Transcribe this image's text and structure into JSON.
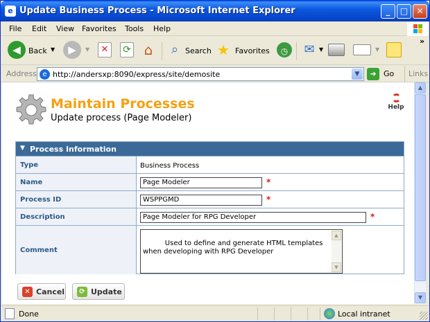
{
  "window": {
    "title": "Update Business Process - Microsoft Internet Explorer"
  },
  "menu": [
    "File",
    "Edit",
    "View",
    "Favorites",
    "Tools",
    "Help"
  ],
  "toolbar": {
    "back_label": "Back",
    "search_label": "Search",
    "favorites_label": "Favorites"
  },
  "address": {
    "label": "Address",
    "url": "http://andersxp:8090/express/site/demosite",
    "go_label": "Go",
    "links_label": "Links"
  },
  "page": {
    "title": "Maintain Processes",
    "subtitle": "Update process (Page Modeler)",
    "help_label": "Help"
  },
  "panel": {
    "title": "Process Information",
    "type_label": "Type",
    "type_value": "Business Process",
    "name_label": "Name",
    "name_value": "Page Modeler",
    "id_label": "Process ID",
    "id_value": "WSPPGMD",
    "description_label": "Description",
    "description_value": "Page Modeler for RPG Developer",
    "comment_label": "Comment",
    "comment_value": "Used to define and generate HTML templates when developing with RPG Developer",
    "required_mark": "*"
  },
  "buttons": {
    "cancel_label": "Cancel",
    "update_label": "Update"
  },
  "status": {
    "text": "Done",
    "zone": "Local intranet"
  },
  "colors": {
    "title_accent": "#f5a113",
    "panel_header": "#3b6a98",
    "label_text": "#2d5a87",
    "required": "#d0201a"
  }
}
